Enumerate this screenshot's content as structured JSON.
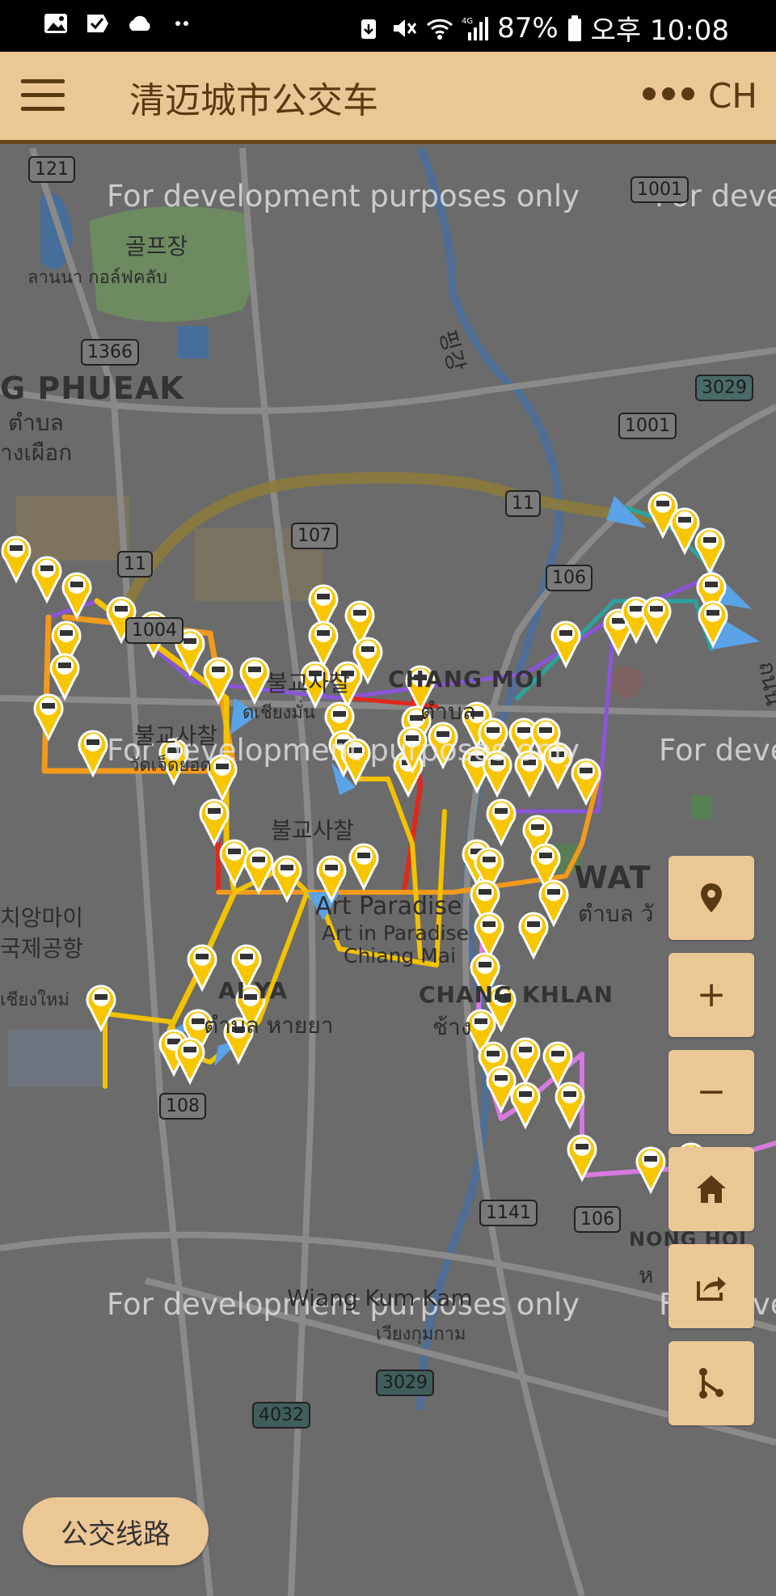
{
  "status_bar": {
    "battery": "87%",
    "time": "오후 10:08",
    "network": "4G",
    "icons": [
      "gallery-icon",
      "check-icon",
      "cloud-icon",
      "more-dots-icon",
      "alarm-icon",
      "mute-icon",
      "wifi-icon",
      "signal-icon",
      "battery-icon"
    ]
  },
  "app_bar": {
    "title": "清迈城市公交车",
    "language": "CH",
    "menu_icon": "hamburger-menu-icon",
    "more_icon": "more-dots-icon"
  },
  "map": {
    "watermark": "For development purposes only",
    "labels": {
      "golf_ko": "골프장",
      "golf_th": "ลานนา กอล์ฟคลับ",
      "chang_phueak": "G PHUEAK",
      "chang_phueak_th1": "ตำบล",
      "chang_phueak_th2": "างเผือก",
      "chang_moi": "CHANG MOI",
      "chang_moi_th": "ตำบล",
      "temple_ko_1": "불교사찰",
      "temple_ko_2": "불교사찰",
      "temple_ko_3": "불교사찰",
      "temple_th": "วัดเจ็ดยอด",
      "temple_th2": "ดเชียงมั่น",
      "airport_ko": "치앙마이",
      "airport_ko2": "국제공항",
      "airport_ko3": "국제공항",
      "airport_th": "เชียงใหม่",
      "art_paradise_1": "Art Paradise",
      "art_paradise_2": "Art in Paradise",
      "art_paradise_3": "Chiang Mai",
      "hai_ya": "AI YA",
      "hai_ya_th": "ตำบล หายยา",
      "wat_ket": "WAT",
      "wat_ket_th": "ตำบล วั",
      "chang_khlan": "CHANG KHLAN",
      "chang_khlan_th": "ช้าง",
      "nong_hoi": "NONG HOI",
      "nong_hoi_th": "ห",
      "wiang_kum_kam": "Wiang Kum Kam",
      "wiang_kum_kam_th": "เวียงกุมกาม",
      "river_ko": "핑강",
      "thanon": "ถนน"
    },
    "road_shields": [
      "121",
      "1001",
      "1366",
      "3029",
      "1001",
      "11",
      "107",
      "106",
      "11",
      "1004",
      "108",
      "1141",
      "106",
      "3029",
      "4032"
    ]
  },
  "controls": {
    "location_icon": "location-pin-icon",
    "zoom_in": "+",
    "zoom_out": "−",
    "home_icon": "home-icon",
    "share_icon": "share-icon",
    "route_icon": "route-icon"
  },
  "routes_button": "公交线路",
  "colors": {
    "app_bar": "#ecc796",
    "app_bar_border": "#6b4418",
    "map_bg": "#6b6b6b",
    "route_yellow": "#f2c200",
    "route_orange": "#f29a1c",
    "route_red": "#e0281c",
    "route_purple": "#8a55d8",
    "route_pink": "#d67ae0",
    "route_teal": "#2aa3a0",
    "bus_marker": "#f7c600",
    "arrow": "#5aa3e6"
  }
}
